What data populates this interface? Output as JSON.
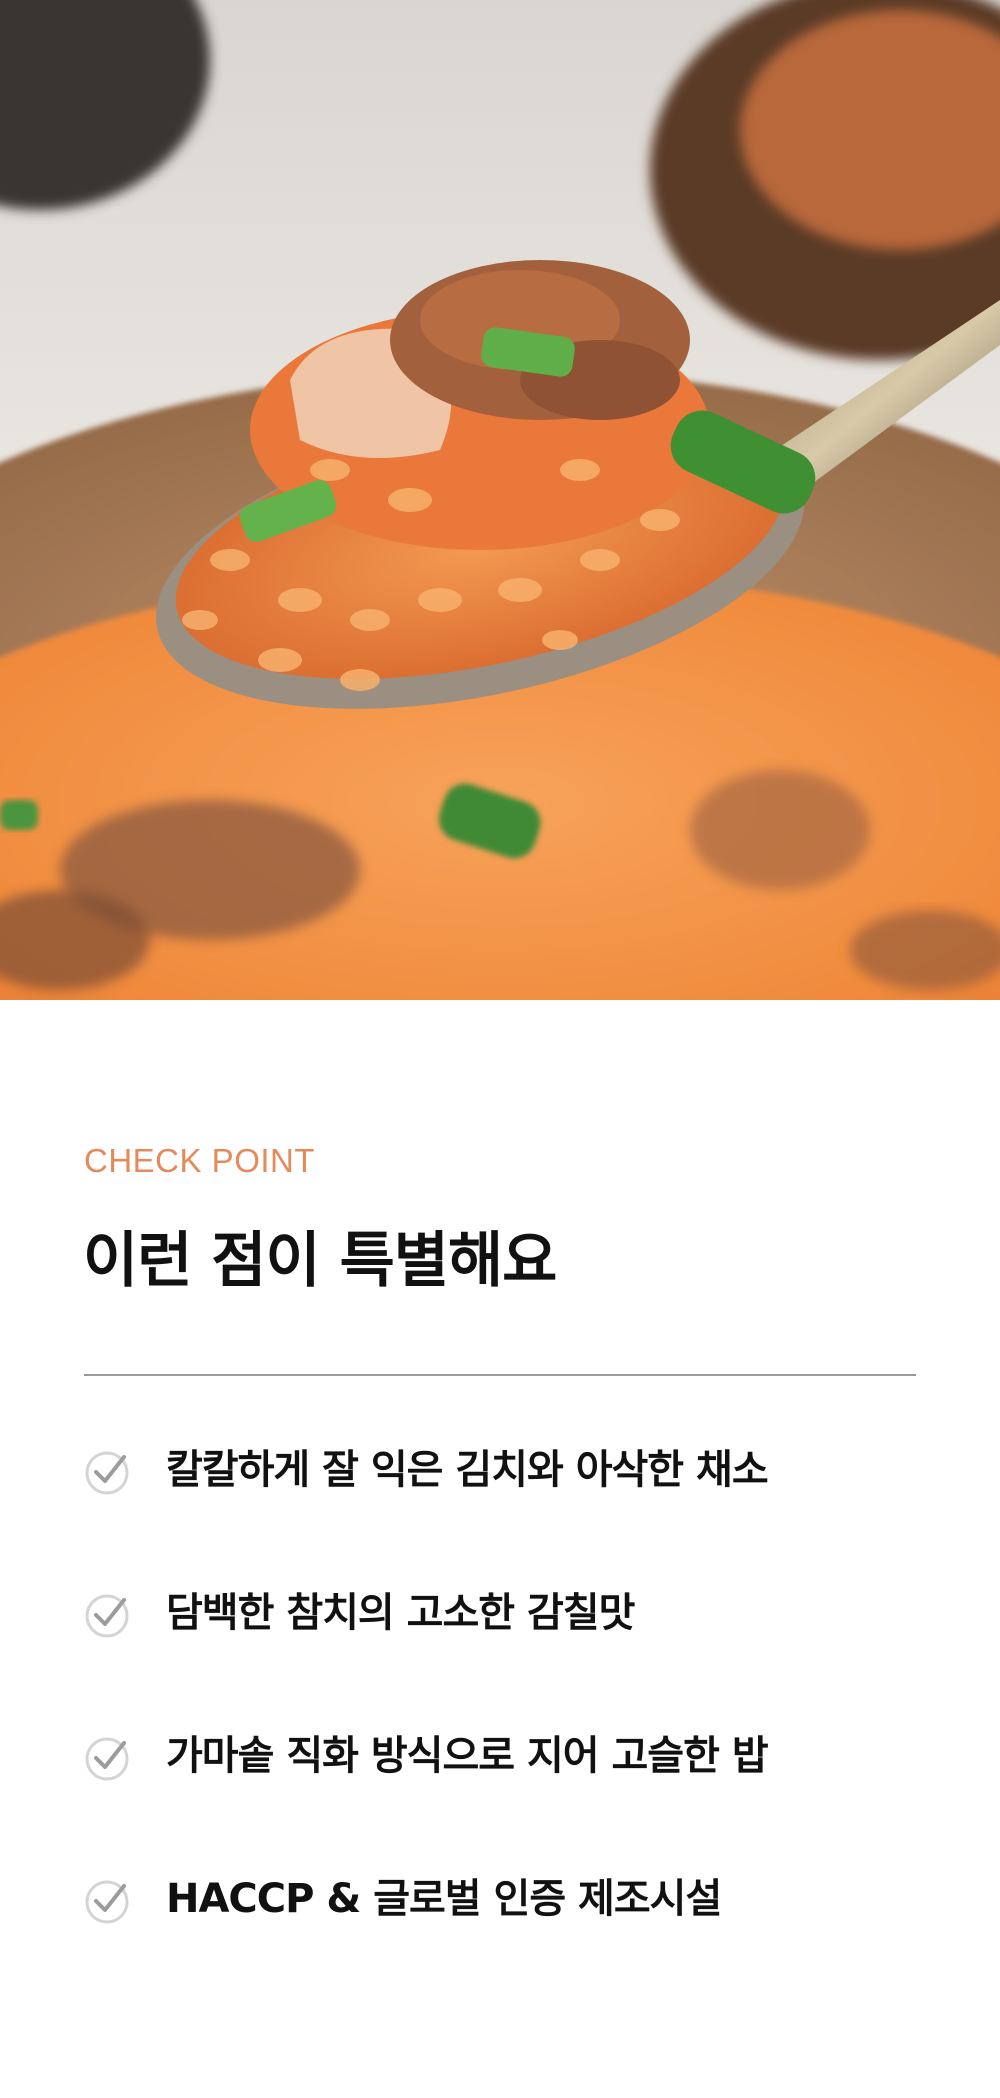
{
  "hero": {
    "image_icon": "spoon-of-kimchi-tuna-fried-rice-photo"
  },
  "section": {
    "eyebrow": "CHECK POINT",
    "title": "이런 점이 특별해요"
  },
  "points": [
    {
      "icon": "check-icon",
      "text": "칼칼하게 잘 익은 김치와 아삭한 채소"
    },
    {
      "icon": "check-icon",
      "text": "담백한 참치의 고소한 감칠맛"
    },
    {
      "icon": "check-icon",
      "text": "가마솥 직화 방식으로 지어 고슬한 밥"
    },
    {
      "icon": "check-icon",
      "text": "HACCP & 글로벌 인증 제조시설"
    }
  ],
  "colors": {
    "eyebrow": "#e58a5a",
    "text": "#111111",
    "divider": "#9a9a9a",
    "check_stroke": "#9c9c9c",
    "check_circle": "#d4d4d4"
  }
}
